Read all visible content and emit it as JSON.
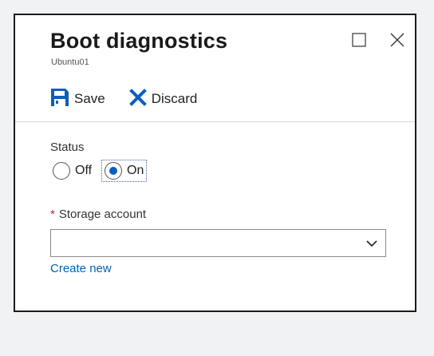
{
  "blade": {
    "title": "Boot diagnostics",
    "subtitle": "Ubuntu01"
  },
  "window_controls": {
    "maximize_icon": "square-maximize-icon",
    "close_icon": "x-close-icon"
  },
  "toolbar": {
    "save_label": "Save",
    "save_icon": "floppy-disk-icon",
    "discard_label": "Discard",
    "discard_icon": "x-discard-icon"
  },
  "form": {
    "status_label": "Status",
    "status_options": [
      {
        "label": "Off",
        "selected": false
      },
      {
        "label": "On",
        "selected": true
      }
    ],
    "storage_required_marker": "*",
    "storage_label": "Storage account",
    "storage_value": "",
    "create_new_label": "Create new"
  },
  "colors": {
    "accent": "#0a5ec0",
    "link": "#0063b1",
    "required": "#c62828",
    "background": "#f1f2f4"
  }
}
